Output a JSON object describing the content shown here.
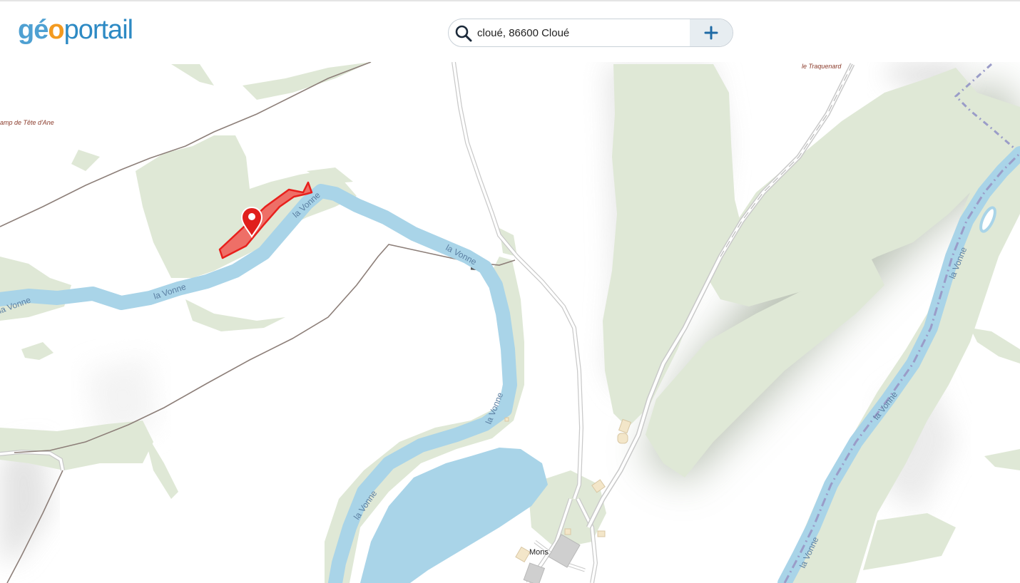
{
  "header": {
    "logo": {
      "part1": "gé",
      "part2": "o",
      "part3": "portail"
    },
    "search": {
      "value": "cloué, 86600 Cloué",
      "placeholder": ""
    }
  },
  "map": {
    "labels": {
      "traquenard": "le Traquenard",
      "camp": "amp de Tête d'Ane",
      "mons": "Mons",
      "vonne_1": "la Vonne",
      "vonne_2": "la Vonne",
      "vonne_3": "la Vonne",
      "vonne_4": "la Vonne",
      "vonne_5": "la Vonne",
      "vonne_6": "la Vonne",
      "vonne_7": "la Vonne",
      "vonne_8": "la Vonne",
      "vonne_9": "la Vonne"
    },
    "colors": {
      "forest": "#dfe8d6",
      "water": "#a9d4e8",
      "water_label": "#5b7fa2",
      "track": "#8d7f79",
      "highlight": "#e8201c",
      "highlight_fill": "#ee6f67",
      "hillshade": "#a9b3a2",
      "border": "#9a9cc8"
    }
  }
}
